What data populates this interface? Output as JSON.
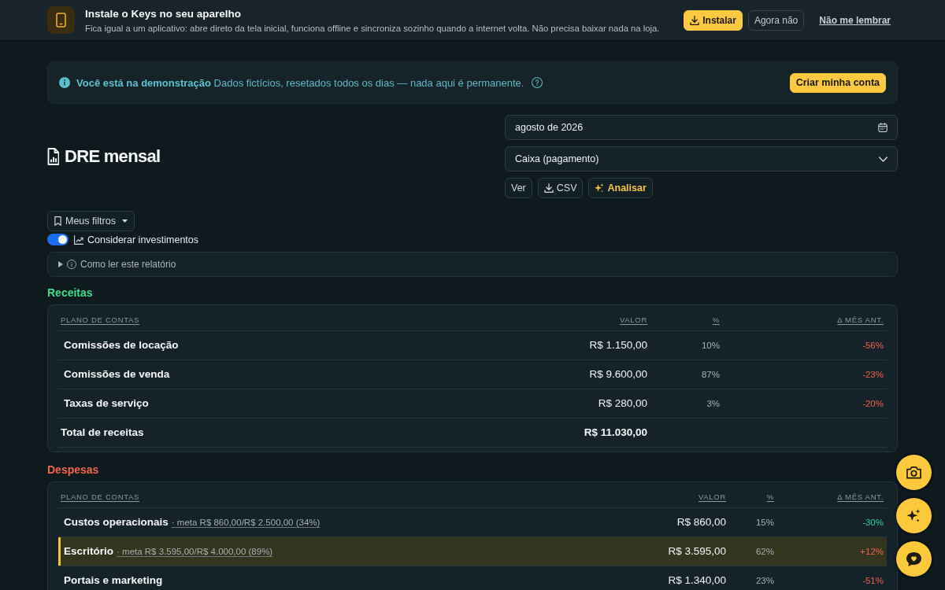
{
  "install_banner": {
    "title": "Instale o Keys no seu aparelho",
    "description": "Fica igual a um aplicativo: abre direto da tela inicial, funciona offline e sincroniza sozinho quando a internet volta. Não precisa baixar nada na loja.",
    "buttons": [
      {
        "kind": "primary",
        "label": "Instalar"
      },
      {
        "kind": "secondary",
        "label": "Agora não"
      },
      {
        "kind": "link",
        "label": "Não me lembrar"
      }
    ]
  },
  "demo_notice": {
    "text": "**Você está na demonstração** Dados fictícios, resetados todos os dias — nada aqui é permanente.",
    "button": "Criar minha conta"
  },
  "report": {
    "title": "DRE mensal",
    "period": "agosto de 2026",
    "basis": "Caixa (pagamento)",
    "actions": [
      {
        "kind": "view",
        "label": "Ver"
      },
      {
        "kind": "download",
        "label": "CSV"
      },
      {
        "kind": "analyze",
        "label": "Analisar"
      }
    ]
  },
  "filters": {
    "saved_filters": "Meus filtros",
    "investments": {
      "label": "Considerar investimentos",
      "on": true
    },
    "help": {
      "label": "Como ler este relatório",
      "expanded": false
    }
  },
  "sections": [
    {
      "kind": "revenue",
      "title": "Receitas",
      "columns": [
        "PLANO DE CONTAS",
        "VALOR",
        "%",
        "Δ MÊS ANT."
      ],
      "rows": [
        {
          "kind": "item",
          "account": "Comissões de locação",
          "value": "R$ 1.150,00",
          "share": "10%",
          "change": "-56%",
          "favorable": false,
          "highlighted": false
        },
        {
          "kind": "item",
          "account": "Comissões de venda",
          "value": "R$ 9.600,00",
          "share": "87%",
          "change": "-23%",
          "favorable": false,
          "highlighted": false
        },
        {
          "kind": "item",
          "account": "Taxas de serviço",
          "value": "R$ 280,00",
          "share": "3%",
          "change": "-20%",
          "favorable": false,
          "highlighted": false
        },
        {
          "kind": "total",
          "account": "Total de receitas",
          "value": "R$ 11.030,00"
        }
      ]
    },
    {
      "kind": "expense",
      "title": "Despesas",
      "columns": [
        "PLANO DE CONTAS",
        "VALOR",
        "%",
        "Δ MÊS ANT."
      ],
      "rows": [
        {
          "kind": "item",
          "account": "Custos operacionais",
          "budget": "· meta R$ 860,00/R$ 2.500,00 (34%)",
          "value": "R$ 860,00",
          "share": "15%",
          "change": "-30%",
          "favorable": true,
          "highlighted": false
        },
        {
          "kind": "item",
          "account": "Escritório",
          "budget": "· meta R$ 3.595,00/R$ 4.000,00 (89%)",
          "value": "R$ 3.595,00",
          "share": "62%",
          "change": "+12%",
          "favorable": false,
          "highlighted": true
        },
        {
          "kind": "item",
          "account": "Portais e marketing",
          "value": "R$ 1.340,00",
          "share": "23%",
          "change": "-51%",
          "favorable": false,
          "highlighted": false
        }
      ]
    }
  ],
  "floating_buttons": [
    {
      "kind": "camera"
    },
    {
      "kind": "assistant"
    },
    {
      "kind": "chat"
    }
  ]
}
